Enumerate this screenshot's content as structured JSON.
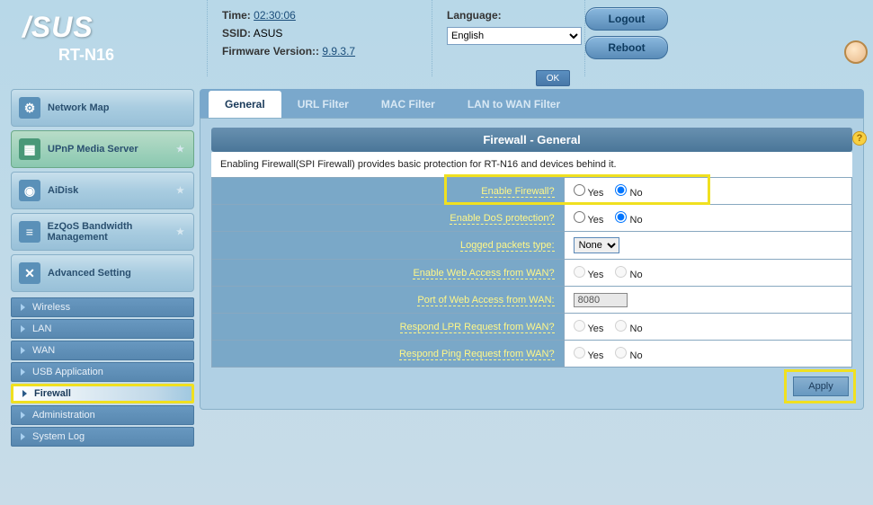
{
  "header": {
    "brand": "/SUS",
    "model": "RT-N16",
    "time_label": "Time:",
    "time_value": "02:30:06",
    "ssid_label": "SSID:",
    "ssid_value": "ASUS",
    "fw_label": "Firmware Version::",
    "fw_value": "9.9.3.7",
    "lang_label": "Language:",
    "lang_value": "English",
    "lang_ok": "OK",
    "logout": "Logout",
    "reboot": "Reboot"
  },
  "sidebar": {
    "items": [
      {
        "label": "Network Map"
      },
      {
        "label": "UPnP Media Server"
      },
      {
        "label": "AiDisk"
      },
      {
        "label": "EzQoS Bandwidth Management"
      },
      {
        "label": "Advanced Setting"
      }
    ],
    "sub": [
      {
        "label": "Wireless"
      },
      {
        "label": "LAN"
      },
      {
        "label": "WAN"
      },
      {
        "label": "USB Application"
      },
      {
        "label": "Firewall"
      },
      {
        "label": "Administration"
      },
      {
        "label": "System Log"
      }
    ]
  },
  "tabs": [
    {
      "label": "General"
    },
    {
      "label": "URL Filter"
    },
    {
      "label": "MAC Filter"
    },
    {
      "label": "LAN to WAN Filter"
    }
  ],
  "panel": {
    "title": "Firewall - General",
    "desc": "Enabling Firewall(SPI Firewall) provides basic protection for RT-N16 and devices behind it.",
    "yes": "Yes",
    "no": "No",
    "rows": {
      "enable_fw": "Enable Firewall?",
      "enable_dos": "Enable DoS protection?",
      "logged_type": "Logged packets type:",
      "logged_value": "None",
      "web_wan": "Enable Web Access from WAN?",
      "port_wan": "Port of Web Access from WAN:",
      "port_value": "8080",
      "lpr": "Respond LPR Request from WAN?",
      "ping": "Respond Ping Request from WAN?"
    },
    "apply": "Apply"
  }
}
